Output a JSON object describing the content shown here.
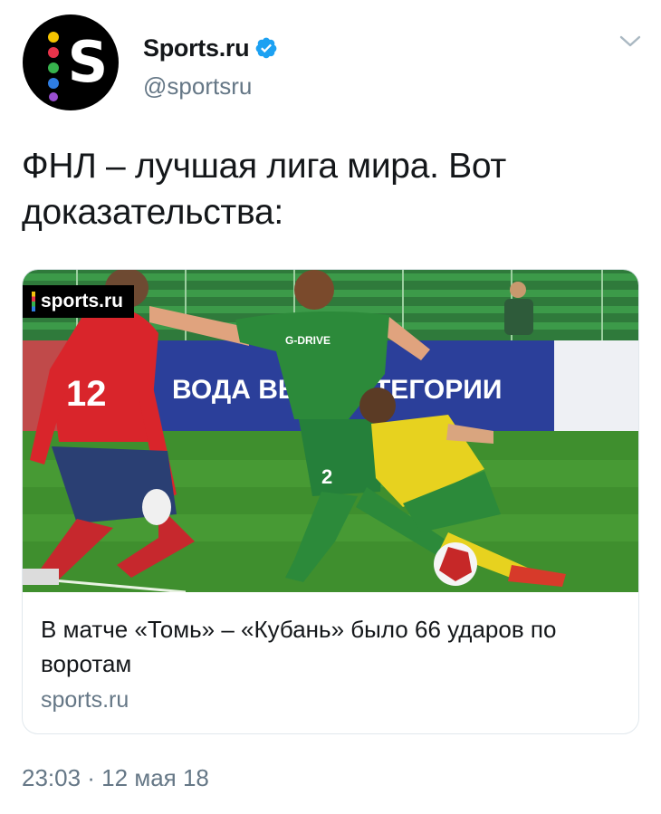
{
  "author": {
    "display_name": "Sports.ru",
    "handle": "@sportsru",
    "avatar_letter": "S",
    "verified": true
  },
  "tweet": {
    "text": "ФНЛ – лучшая лига мира. Вот доказательства:",
    "timestamp": "23:03 · 12 мая 18"
  },
  "card": {
    "watermark": "sports.ru",
    "title": "В матче «Томь» – «Кубань» было 66 ударов по воротам",
    "domain": "sports.ru",
    "banner_text": "ВОДА ВЫ      Й КАТЕГОРИИ",
    "jersey_text": "G-DRIVE",
    "player_numbers": [
      "12",
      "2"
    ]
  },
  "icons": {
    "verified": "verified-badge-icon",
    "caret": "chevron-down-icon"
  },
  "colors": {
    "text_primary": "#14171a",
    "text_secondary": "#657786",
    "verified_blue": "#1da1f2",
    "border": "#e1e8ed",
    "pitch_green": "#3f8f2e",
    "banner_blue": "#2b3f9a",
    "goalkeeper_red": "#d9252b",
    "home_green": "#2c8a3a",
    "away_yellow": "#e7d21f"
  }
}
